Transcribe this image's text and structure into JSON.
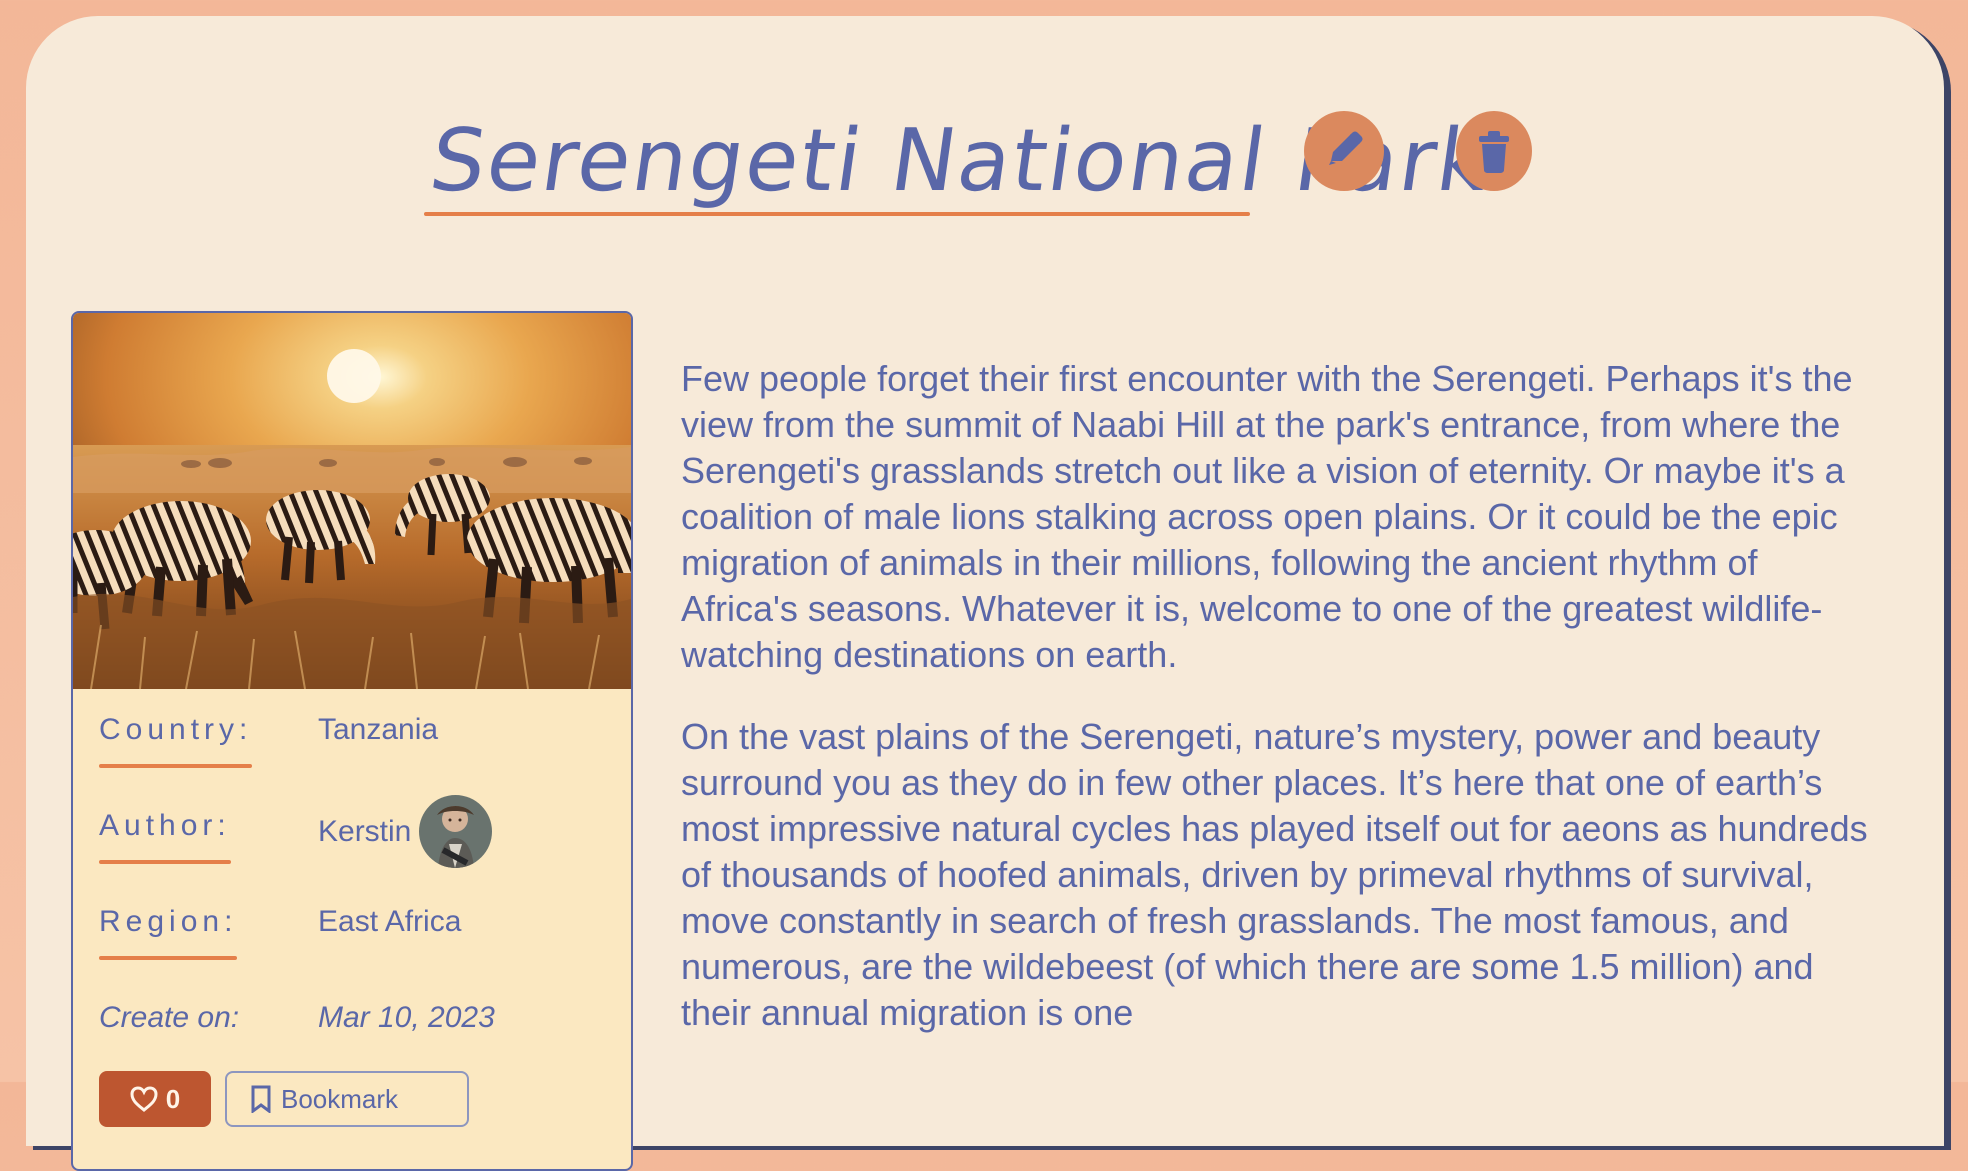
{
  "title": "Serengeti National Park",
  "actions": {
    "edit_icon": "pencil-icon",
    "delete_icon": "trash-icon"
  },
  "details": {
    "country_label": "Country:",
    "country_value": "Tanzania",
    "author_label": "Author:",
    "author_value": "Kerstin",
    "region_label": "Region:",
    "region_value": "East Africa",
    "created_label": "Create on:",
    "created_value": "Mar 10, 2023"
  },
  "buttons": {
    "like_count": "0",
    "bookmark_label": "Bookmark"
  },
  "description": {
    "paragraph_1": "Few people forget their first encounter with the Serengeti. Perhaps it's the view from the summit of Naabi Hill at the park's entrance, from where the Serengeti's grasslands stretch out like a vision of eternity. Or maybe it's a coalition of male lions stalking across open plains. Or it could be the epic migration of animals in their millions, following the ancient rhythm of Africa's seasons. Whatever it is, welcome to one of the greatest wildlife-watching destinations on earth.",
    "paragraph_2": "On the vast plains of the Serengeti, nature’s mystery, power and beauty surround you as they do in few other places. It’s here that one of earth’s most impressive natural cycles has played itself out for aeons as hundreds of thousands of hoofed animals, driven by primeval rhythms of survival, move constantly in search of fresh grasslands. The most famous, and numerous, are the wildebeest (of which there are some 1.5 million) and their annual migration is one"
  },
  "colors": {
    "background": "#f3b798",
    "card": "#f7ead9",
    "info_card": "#fbe8c1",
    "text": "#5a67a8",
    "accent": "#e57f49",
    "button": "#db895e",
    "like_button": "#bd5630"
  }
}
